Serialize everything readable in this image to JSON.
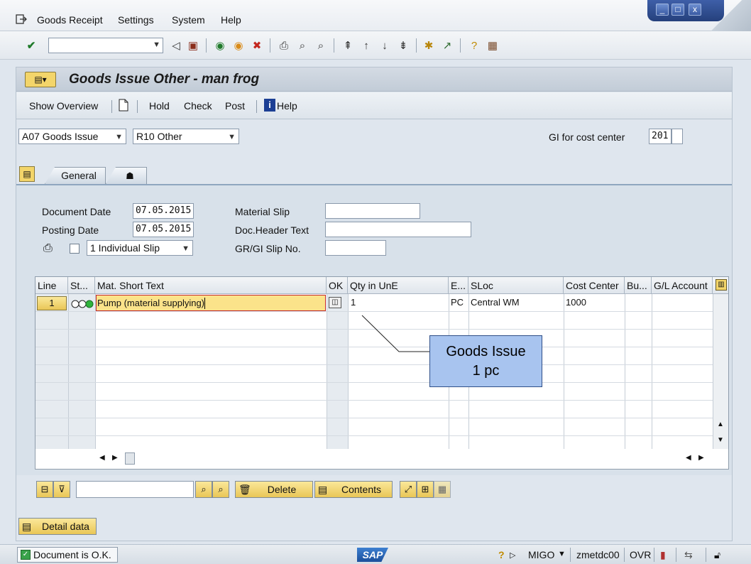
{
  "menu": {
    "items": [
      "Goods Receipt",
      "Settings",
      "System",
      "Help"
    ],
    "window_controls": [
      "_",
      "□",
      "x"
    ]
  },
  "toolbar": {
    "command_field_value": "",
    "icons": [
      "enter-icon",
      "back-triangle-icon",
      "save-icon",
      "back-icon",
      "exit-icon",
      "cancel-icon",
      "print-icon",
      "find-icon",
      "find-next-icon",
      "first-page-icon",
      "previous-page-icon",
      "next-page-icon",
      "last-page-icon",
      "new-session-icon",
      "shortcut-icon",
      "help-icon",
      "layout-icon"
    ]
  },
  "header": {
    "title": "Goods Issue Other - man frog",
    "app_buttons": {
      "show_overview": "Show Overview",
      "hold": "Hold",
      "check": "Check",
      "post": "Post",
      "help": "Help"
    }
  },
  "selection": {
    "action": "A07 Goods Issue",
    "reference": "R10 Other",
    "gi_label": "GI for cost center",
    "movement_type": "201"
  },
  "tabs": {
    "general": "General"
  },
  "general": {
    "document_date_label": "Document Date",
    "document_date": "07.05.2015",
    "posting_date_label": "Posting Date",
    "posting_date": "07.05.2015",
    "slip_option": "1 Individual Slip",
    "material_slip_label": "Material Slip",
    "material_slip": "",
    "doc_header_label": "Doc.Header Text",
    "doc_header": "",
    "gr_gi_label": "GR/GI Slip No.",
    "gr_gi": ""
  },
  "grid": {
    "columns": [
      "Line",
      "St...",
      "Mat. Short Text",
      "OK",
      "Qty in UnE",
      "E...",
      "SLoc",
      "Cost Center",
      "Bu...",
      "G/L Account"
    ],
    "rows": [
      {
        "line": "1",
        "mat_short_text": "Pump  (material supplying)",
        "qty": "1",
        "unit": "PC",
        "sloc": "Central WM",
        "cost_center": "1000",
        "bu": "",
        "gl_account": ""
      }
    ]
  },
  "callout": {
    "line1": "Goods Issue",
    "line2": "1 pc"
  },
  "bottom_toolbar": {
    "search_value": "",
    "delete": "Delete",
    "contents": "Contents",
    "detail_data": "Detail data"
  },
  "status": {
    "message": "Document is O.K.",
    "brand": "SAP",
    "transaction": "MIGO",
    "server": "zmetdc00",
    "mode": "OVR"
  },
  "colors": {
    "accent_yellow": "#f3d56a",
    "selected_cell": "#fbe38a",
    "callout_fill": "#a8c4ef",
    "status_ok": "#39a24a"
  }
}
